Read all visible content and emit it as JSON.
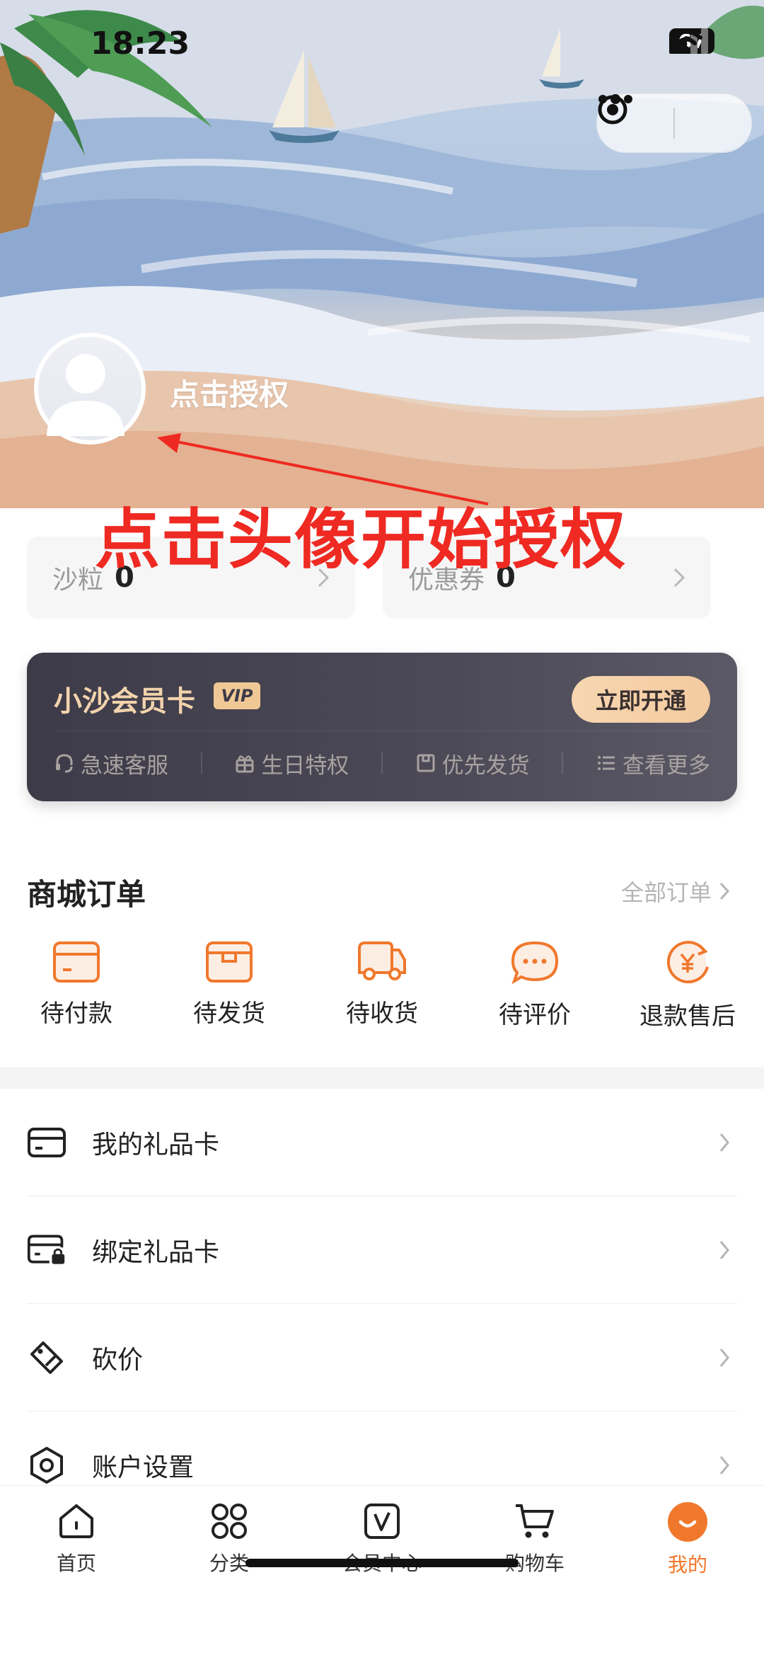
{
  "status_bar": {
    "time": "18:23",
    "battery": "67"
  },
  "profile": {
    "auth_text": "点击授权"
  },
  "annotation": {
    "text": "点击头像开始授权",
    "color": "#ee2a22"
  },
  "stats": [
    {
      "label": "沙粒",
      "value": "0"
    },
    {
      "label": "优惠券",
      "value": "0"
    }
  ],
  "vip_card": {
    "title": "小沙会员卡",
    "badge": "VIP",
    "button": "立即开通",
    "perks": [
      {
        "label": "急速客服",
        "icon": "headset-icon"
      },
      {
        "label": "生日特权",
        "icon": "gift-icon"
      },
      {
        "label": "优先发货",
        "icon": "package-icon"
      },
      {
        "label": "查看更多",
        "icon": "list-icon"
      }
    ]
  },
  "orders": {
    "title": "商城订单",
    "all_label": "全部订单",
    "items": [
      {
        "label": "待付款",
        "icon": "wallet-icon"
      },
      {
        "label": "待发货",
        "icon": "box-icon"
      },
      {
        "label": "待收货",
        "icon": "truck-icon"
      },
      {
        "label": "待评价",
        "icon": "chat-bubble-icon"
      },
      {
        "label": "退款售后",
        "icon": "yuan-refund-icon"
      }
    ]
  },
  "menu": [
    {
      "label": "我的礼品卡",
      "icon": "gift-card-icon"
    },
    {
      "label": "绑定礼品卡",
      "icon": "card-lock-icon"
    },
    {
      "label": "砍价",
      "icon": "price-tag-icon"
    },
    {
      "label": "账户设置",
      "icon": "settings-icon"
    }
  ],
  "tabbar": {
    "active": "我的",
    "items": [
      {
        "label": "首页",
        "icon": "home-icon"
      },
      {
        "label": "分类",
        "icon": "category-icon"
      },
      {
        "label": "会员中心",
        "icon": "vip-center-icon"
      },
      {
        "label": "购物车",
        "icon": "cart-icon"
      },
      {
        "label": "我的",
        "icon": "profile-smile-icon"
      }
    ]
  },
  "colors": {
    "accent": "#f0782c",
    "vip_gold": "#f2d3ac",
    "vip_bg": "#3d3b48"
  }
}
